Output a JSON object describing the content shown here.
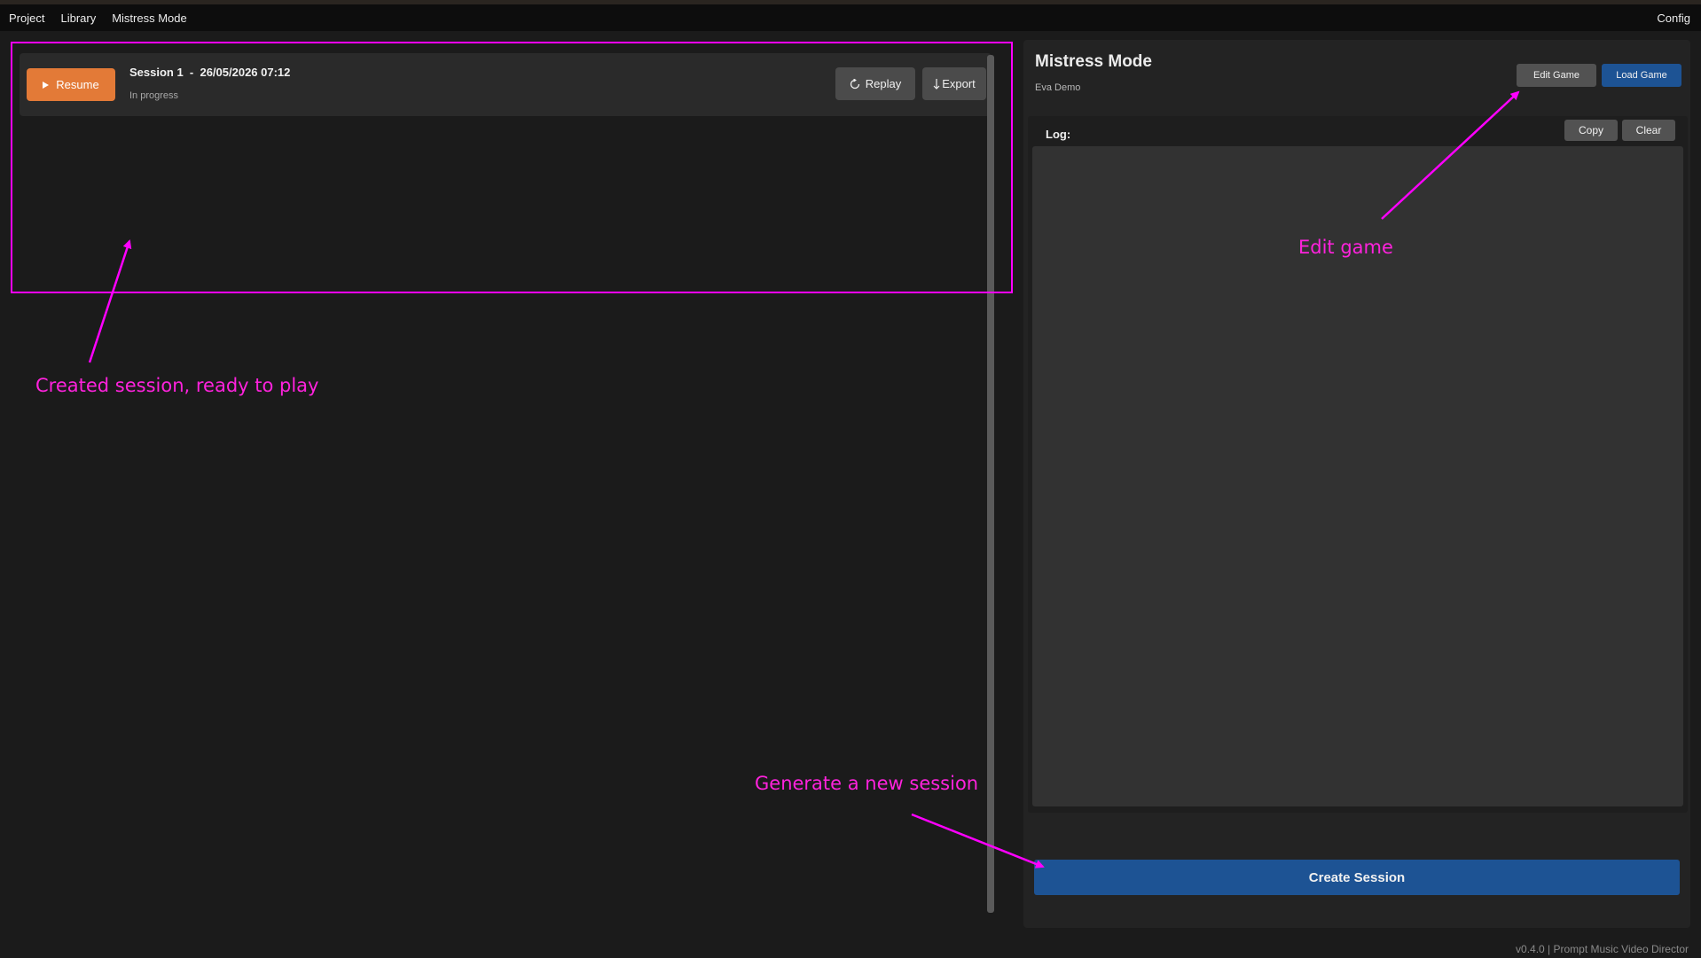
{
  "menubar": {
    "items": [
      "Project",
      "Library",
      "Mistress Mode"
    ],
    "config_label": "Config"
  },
  "session": {
    "resume_label": "Resume",
    "title": "Session 1  -  26/05/2026 07:12",
    "status": "In progress",
    "replay_label": "Replay",
    "export_label": "Export"
  },
  "panel": {
    "title": "Mistress Mode",
    "subtitle": "Eva Demo",
    "edit_game_label": "Edit Game",
    "load_game_label": "Load Game",
    "log_label": "Log:",
    "copy_label": "Copy",
    "clear_label": "Clear",
    "create_session_label": "Create Session"
  },
  "footer": {
    "version_text": "v0.4.0 | Prompt Music Video Director"
  },
  "annotations": {
    "session_note": "Created session, ready to play",
    "edit_note": "Edit game",
    "create_note": "Generate a new session"
  },
  "colors": {
    "accent_orange": "#e37a37",
    "accent_blue": "#1d5394",
    "annotation_magenta": "#ff00ff"
  }
}
